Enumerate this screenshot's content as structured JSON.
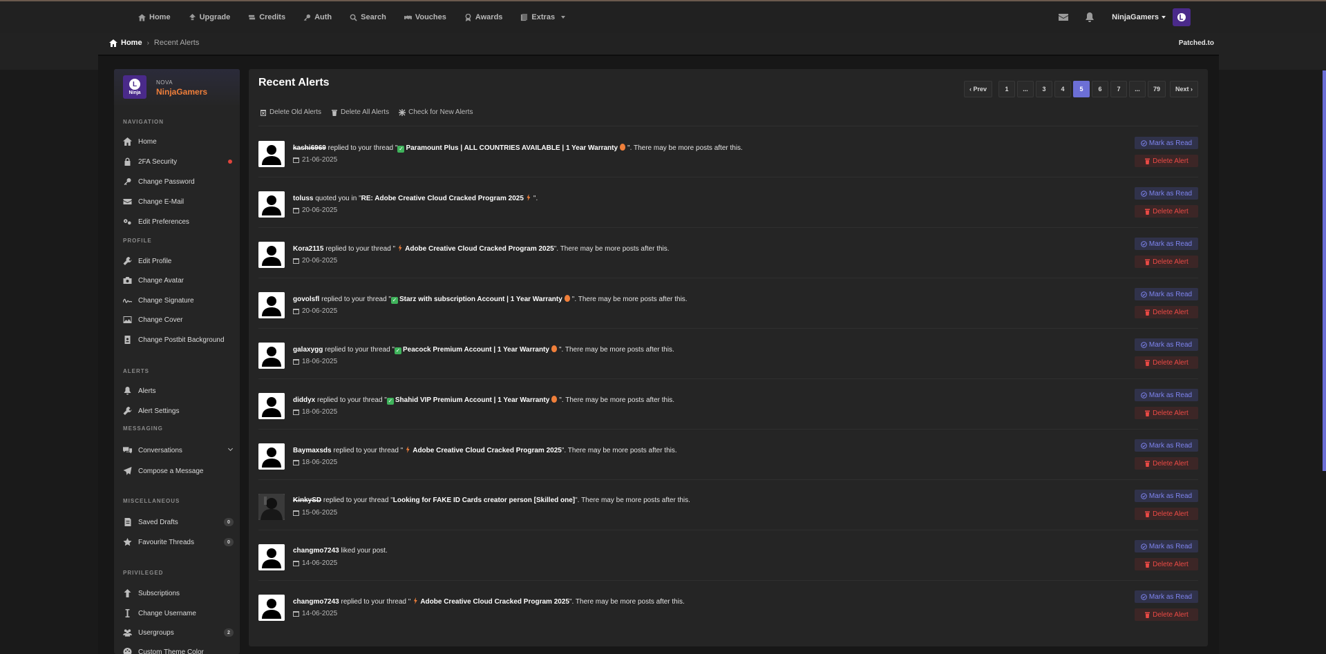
{
  "topnav": {
    "items": [
      {
        "label": "Home",
        "icon": "home-icon"
      },
      {
        "label": "Upgrade",
        "icon": "upgrade-icon"
      },
      {
        "label": "Credits",
        "icon": "credits-icon"
      },
      {
        "label": "Auth",
        "icon": "key-icon"
      },
      {
        "label": "Search",
        "icon": "search-icon"
      },
      {
        "label": "Vouches",
        "icon": "handshake-icon"
      },
      {
        "label": "Awards",
        "icon": "award-icon"
      },
      {
        "label": "Extras",
        "icon": "extras-icon"
      }
    ],
    "username": "NinjaGamers"
  },
  "breadcrumb": {
    "home": "Home",
    "current": "Recent Alerts"
  },
  "site_name": "Patched.to",
  "profile": {
    "avatar_letter": "L",
    "avatar_tag": "Ninja",
    "rank": "NOVA",
    "name": "NinjaGamers"
  },
  "sidebar": {
    "sections": {
      "navigation": "NAVIGATION",
      "profile": "PROFILE",
      "alerts": "ALERTS",
      "messaging": "MESSAGING",
      "misc": "MISCELLANEOUS",
      "privileged": "PRIVILEGED"
    },
    "items": {
      "home": "Home",
      "twofa": "2FA Security",
      "change_password": "Change Password",
      "change_email": "Change E-Mail",
      "edit_prefs": "Edit Preferences",
      "edit_profile": "Edit Profile",
      "change_avatar": "Change Avatar",
      "change_signature": "Change Signature",
      "change_cover": "Change Cover",
      "change_postbit": "Change Postbit Background",
      "alerts": "Alerts",
      "alert_settings": "Alert Settings",
      "conversations": "Conversations",
      "compose": "Compose a Message",
      "saved_drafts": "Saved Drafts",
      "saved_drafts_count": "0",
      "fav_threads": "Favourite Threads",
      "fav_threads_count": "0",
      "subscriptions": "Subscriptions",
      "change_username": "Change Username",
      "usergroups": "Usergroups",
      "usergroups_count": "2",
      "custom_theme": "Custom Theme Color"
    }
  },
  "main": {
    "title": "Recent Alerts",
    "pager": {
      "prev": "Prev",
      "pages": [
        "1",
        "...",
        "3",
        "4",
        "5",
        "6",
        "7",
        "...",
        "79"
      ],
      "active": "5",
      "next": "Next"
    },
    "actions": {
      "delete_old": "Delete Old Alerts",
      "delete_all": "Delete All Alerts",
      "check_new": "Check for New Alerts"
    },
    "mark_read_label": "Mark as Read",
    "delete_label": "Delete Alert",
    "alerts": [
      {
        "user": "kashi6969",
        "action": "replied to your thread",
        "thread": "Paramount Plus | ALL COUNTRIES AVAILABLE | 1 Year Warranty",
        "suffix": "There may be more posts after this.",
        "date": "21-06-2025"
      },
      {
        "user": "toluss",
        "action": "quoted you in",
        "thread": "RE: Adobe Creative Cloud Cracked Program 2025",
        "suffix": "",
        "date": "20-06-2025"
      },
      {
        "user": "Kora2115",
        "action": "replied to your thread",
        "thread": "Adobe Creative Cloud Cracked Program 2025",
        "suffix": "There may be more posts after this.",
        "date": "20-06-2025"
      },
      {
        "user": "govolsfl",
        "action": "replied to your thread",
        "thread": "Starz with subscription Account | 1 Year Warranty",
        "suffix": "There may be more posts after this.",
        "date": "20-06-2025"
      },
      {
        "user": "galaxygg",
        "action": "replied to your thread",
        "thread": "Peacock Premium Account | 1 Year Warranty",
        "suffix": "There may be more posts after this.",
        "date": "18-06-2025"
      },
      {
        "user": "diddyx",
        "action": "replied to your thread",
        "thread": "Shahid VIP Premium Account | 1 Year Warranty",
        "suffix": "There may be more posts after this.",
        "date": "18-06-2025"
      },
      {
        "user": "Baymaxsds",
        "action": "replied to your thread",
        "thread": "Adobe Creative Cloud Cracked Program 2025",
        "suffix": "There may be more posts after this.",
        "date": "18-06-2025"
      },
      {
        "user": "KinkySD",
        "action": "replied to your thread",
        "thread": "Looking for FAKE ID Cards creator person [Skilled one]",
        "suffix": "There may be more posts after this.",
        "date": "15-06-2025"
      },
      {
        "user": "changmo7243",
        "action": "liked your post.",
        "thread": "",
        "suffix": "",
        "date": "14-06-2025"
      },
      {
        "user": "changmo7243",
        "action": "replied to your thread",
        "thread": "Adobe Creative Cloud Cracked Program 2025",
        "suffix": "There may be more posts after this.",
        "date": "14-06-2025"
      }
    ]
  },
  "colors": {
    "accent": "#6c6fd6",
    "profile_name": "#f07f3a",
    "danger": "#ec4a45"
  }
}
